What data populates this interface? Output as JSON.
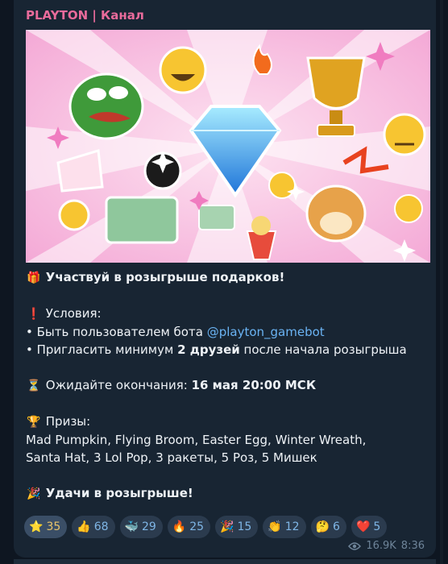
{
  "channel": {
    "title": "PLAYTON | Канал"
  },
  "post": {
    "line1_emoji": "🎁",
    "line1": "Участвуй в розыгрыше подарков!",
    "cond_emoji": "❗",
    "cond_title": "Условия:",
    "bullet1_pre": "• Быть пользователем бота ",
    "bullet1_mention": "@playton_gamebot",
    "bullet2_pre": "• Пригласить минимум ",
    "bullet2_bold": "2 друзей",
    "bullet2_post": " после начала розыгрыша",
    "wait_emoji": "⏳",
    "wait_pre": "Ожидайте окончания: ",
    "wait_bold": "16 мая 20:00 МСК",
    "prize_emoji": "🏆",
    "prize_title": "Призы:",
    "prizes_line1": "Mad Pumpkin, Flying Broom, Easter Egg, Winter Wreath,",
    "prizes_line2": "Santa Hat, 3 Lol Pop, 3 ракеты, 5 Роз, 5 Мишек",
    "luck_emoji": "🎉",
    "luck": "Удачи в розыгрыше!"
  },
  "reactions": [
    {
      "icon": "⭐",
      "count": "35",
      "selected": true
    },
    {
      "icon": "👍",
      "count": "68"
    },
    {
      "icon": "🐳",
      "count": "29"
    },
    {
      "icon": "🔥",
      "count": "25"
    },
    {
      "icon": "🎉",
      "count": "15"
    },
    {
      "icon": "👏",
      "count": "12"
    },
    {
      "icon": "🤔",
      "count": "6"
    },
    {
      "icon": "❤️",
      "count": "5"
    }
  ],
  "meta": {
    "views": "16.9K",
    "time": "8:36"
  }
}
